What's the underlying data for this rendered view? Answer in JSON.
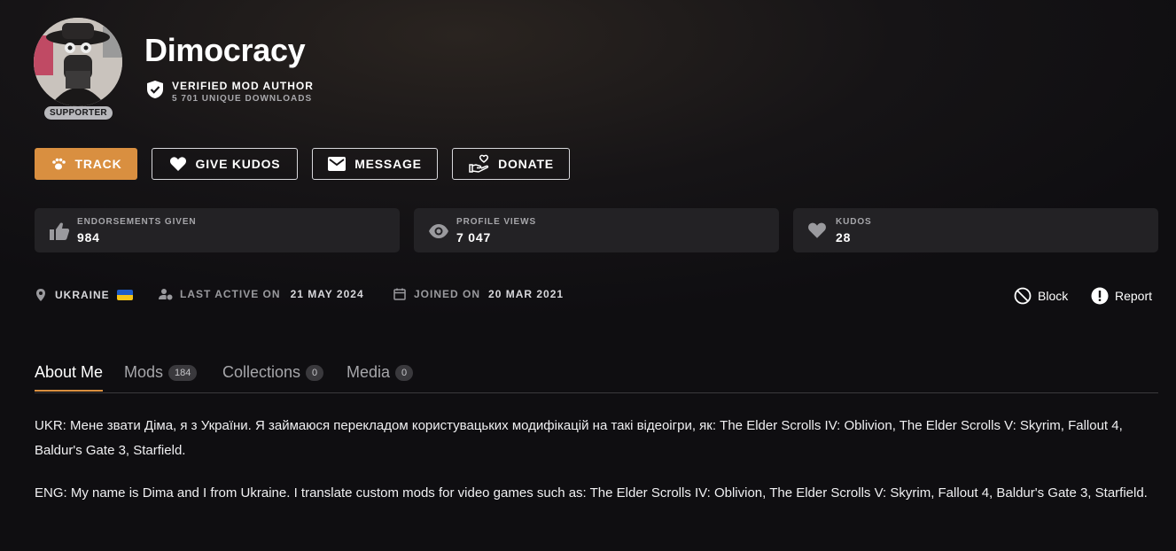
{
  "profile": {
    "username": "Dimocracy",
    "badge": "SUPPORTER",
    "verified_label": "VERIFIED MOD AUTHOR",
    "unique_downloads": "5 701 UNIQUE DOWNLOADS"
  },
  "buttons": {
    "track": "TRACK",
    "give_kudos": "GIVE KUDOS",
    "message": "MESSAGE",
    "donate": "DONATE"
  },
  "stats": [
    {
      "label": "ENDORSEMENTS GIVEN",
      "value": "984",
      "icon": "thumbs-up-icon"
    },
    {
      "label": "PROFILE VIEWS",
      "value": "7 047",
      "icon": "eye-icon"
    },
    {
      "label": "KUDOS",
      "value": "28",
      "icon": "heart-icon"
    }
  ],
  "meta": {
    "country": "UKRAINE",
    "last_active_label": "LAST ACTIVE ON",
    "last_active": "21 MAY 2024",
    "joined_label": "JOINED ON",
    "joined": "20 MAR 2021"
  },
  "actions": {
    "block": "Block",
    "report": "Report"
  },
  "tabs": [
    {
      "label": "About Me",
      "count": null,
      "active": true
    },
    {
      "label": "Mods",
      "count": "184"
    },
    {
      "label": "Collections",
      "count": "0"
    },
    {
      "label": "Media",
      "count": "0"
    }
  ],
  "about": {
    "ukr": "UKR: Мене звати Діма, я з України. Я займаюся перекладом користувацьких модифікацій на такі відеоігри, як: The Elder Scrolls IV: Oblivion, The Elder Scrolls V: Skyrim, Fallout 4, Baldur's Gate 3, Starfield.",
    "eng": "ENG: My name is Dima and I from Ukraine. I translate custom mods for video games such as: The Elder Scrolls IV: Oblivion, The Elder Scrolls V: Skyrim, Fallout 4, Baldur's Gate 3, Starfield."
  },
  "colors": {
    "accent": "#d98f40",
    "flag_blue": "#1d5cc8",
    "flag_yellow": "#f5c518"
  }
}
